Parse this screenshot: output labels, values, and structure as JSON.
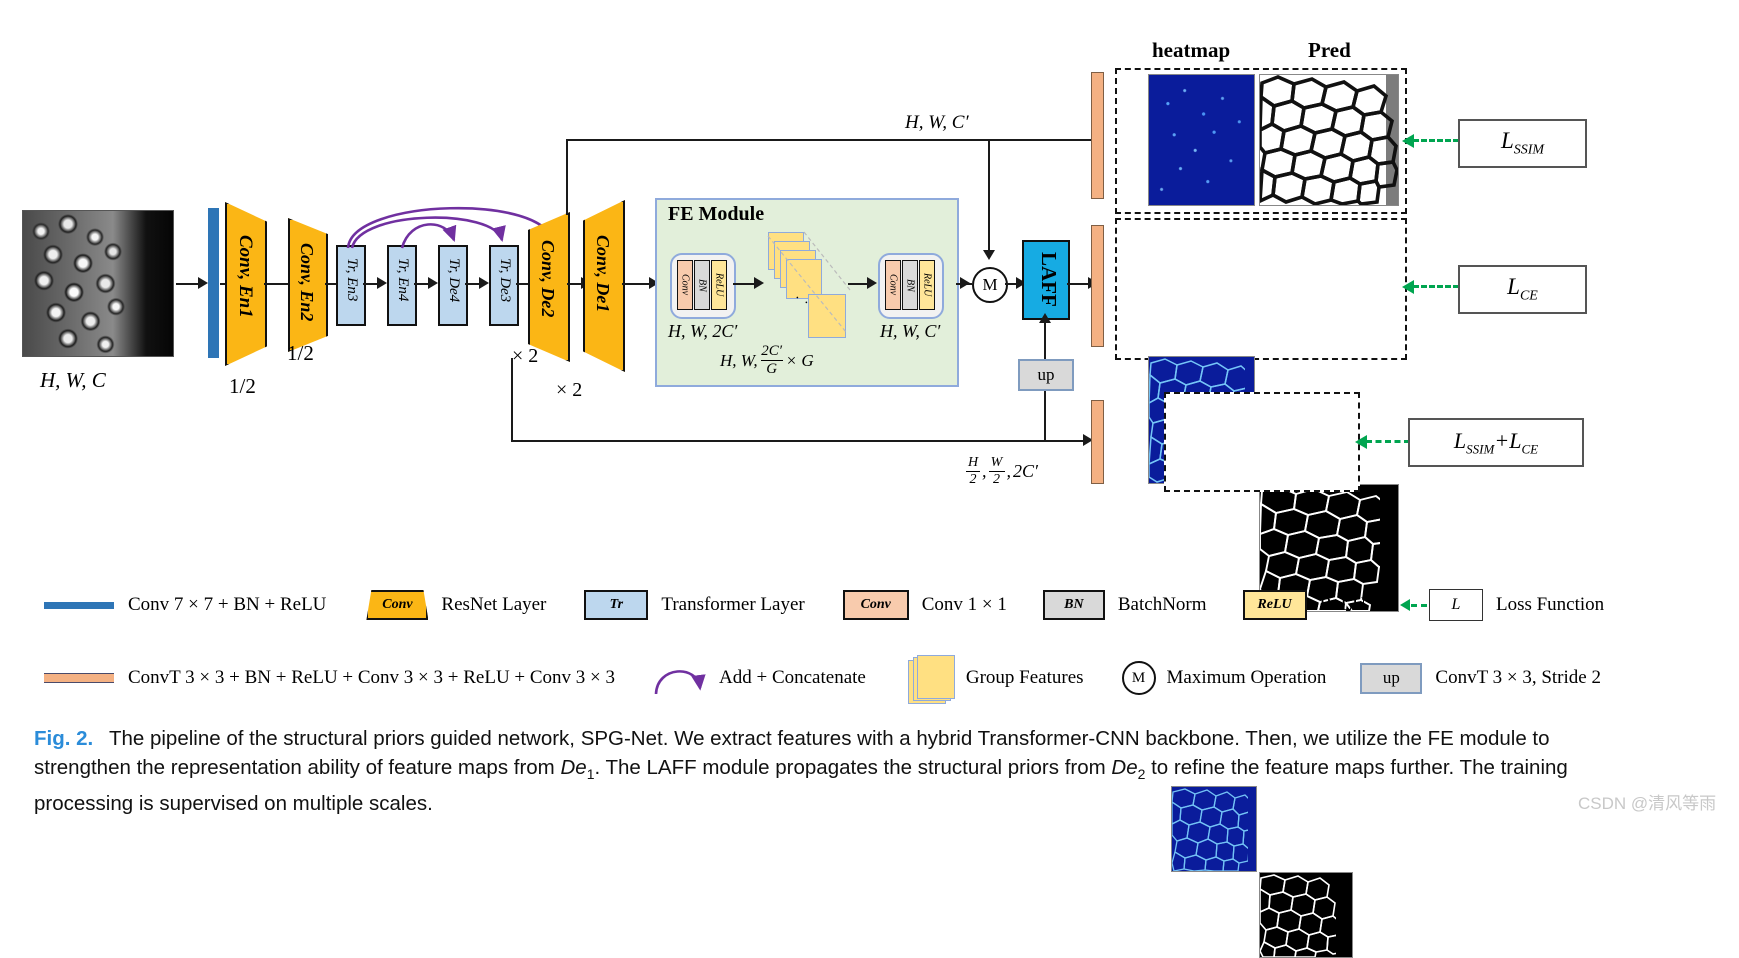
{
  "figure": {
    "number": "Fig. 2.",
    "caption_part1": "The pipeline of the structural priors guided network, SPG-Net. We extract features with a hybrid Transformer-CNN backbone. Then, we utilize the FE module to strengthen the representation ability of feature maps from ",
    "caption_de1": "De",
    "caption_de1_sub": "1",
    "caption_part2": ". The LAFF module propagates the structural priors from ",
    "caption_de2": "De",
    "caption_de2_sub": "2",
    "caption_part3": " to refine the feature maps further. The training processing is supervised on multiple scales.",
    "watermark": "CSDN @清风等雨"
  },
  "input": {
    "dim_label_H": "H",
    "dim_label_W": "W",
    "dim_label_C": "C",
    "dim_label": "H, W, C"
  },
  "backbone": {
    "stem_name": "conv7x7-bn-relu-bar",
    "blocks": [
      {
        "label": "Conv, En1",
        "type": "resnet",
        "scale": "1/2"
      },
      {
        "label": "Conv, En2",
        "type": "resnet",
        "scale": "1/2"
      },
      {
        "label": "Tr, En3",
        "type": "transformer",
        "scale": ""
      },
      {
        "label": "Tr, En4",
        "type": "transformer",
        "scale": ""
      },
      {
        "label": "Tr, De4",
        "type": "transformer",
        "scale": ""
      },
      {
        "label": "Tr, De3",
        "type": "transformer",
        "scale": ""
      },
      {
        "label": "Conv, De2",
        "type": "resnet",
        "scale": "× 2"
      },
      {
        "label": "Conv, De1",
        "type": "resnet",
        "scale": "× 2"
      }
    ]
  },
  "fe_module": {
    "title": "FE Module",
    "block1": {
      "chips": [
        "Conv",
        "BN",
        "ReLU"
      ],
      "dim": "H, W, 2C′"
    },
    "group": {
      "dim_prefix": "H, W,",
      "numerator": "2C′",
      "denominator": "G",
      "suffix": "× G"
    },
    "block2": {
      "chips": [
        "Conv",
        "BN",
        "ReLU"
      ],
      "dim": "H, W, C′"
    }
  },
  "operations": {
    "max_symbol": "M",
    "laff_label": "LAFF",
    "up_label": "up"
  },
  "skip_labels": {
    "top_path": "H, W, C′",
    "bottom_path_H": "H",
    "bottom_path_W": "W",
    "bottom_path_denom": "2",
    "bottom_path_channels": "2C′",
    "bottom_path_full": "H/2, W/2, 2C′"
  },
  "outputs": {
    "column_headers": [
      "heatmap",
      "Pred"
    ],
    "rows": [
      {
        "name": "output-scale-1",
        "loss": "L",
        "loss_sub": "SSIM",
        "loss_full": "L_SSIM"
      },
      {
        "name": "output-scale-2",
        "loss": "L",
        "loss_sub": "CE",
        "loss_full": "L_CE"
      },
      {
        "name": "output-scale-half",
        "loss": "L",
        "loss_sub": "SSIM",
        "loss_extra": "+L",
        "loss_extra_sub": "CE",
        "loss_full": "L_SSIM + L_CE"
      }
    ]
  },
  "legend": {
    "row1": [
      {
        "swatch": "blue-bar",
        "text": "Conv 7 × 7  + BN + ReLU"
      },
      {
        "swatch": "yellow-trapezoid",
        "swatch_label": "Conv",
        "text": "ResNet Layer"
      },
      {
        "swatch": "blue-box",
        "swatch_label": "Tr",
        "text": "Transformer Layer"
      },
      {
        "swatch": "peach-box",
        "swatch_label": "Conv",
        "text": "Conv 1 × 1"
      },
      {
        "swatch": "gray-box",
        "swatch_label": "BN",
        "text": "BatchNorm"
      },
      {
        "swatch": "yellow-box",
        "swatch_label": "ReLU",
        "text": "ReLU"
      },
      {
        "swatch": "green-arrow-L-box",
        "swatch_label": "L",
        "text": "Loss Function"
      }
    ],
    "row2": [
      {
        "swatch": "peach-bar",
        "text": "ConvT 3 × 3 + BN + ReLU + Conv 3 × 3 + ReLU + Conv 3 × 3"
      },
      {
        "swatch": "purple-curved-arrow",
        "text": "Add + Concatenate"
      },
      {
        "swatch": "yellow-stack",
        "text": "Group Features"
      },
      {
        "swatch": "m-circle",
        "swatch_label": "M",
        "text": "Maximum Operation"
      },
      {
        "swatch": "up-box",
        "swatch_label": "up",
        "text": "ConvT  3 × 3, Stride 2"
      }
    ]
  },
  "colors": {
    "resnet_yellow": "#FBB615",
    "transformer_blue": "#BDD7EE",
    "stem_blue": "#2E75B6",
    "convt_peach": "#F4B183",
    "laff_cyan": "#16ABE3",
    "fe_green": "#E2EFDA",
    "loss_green": "#00a550",
    "heatmap_blue": "#0A1C9B",
    "caption_blue": "#2B8CD9"
  }
}
